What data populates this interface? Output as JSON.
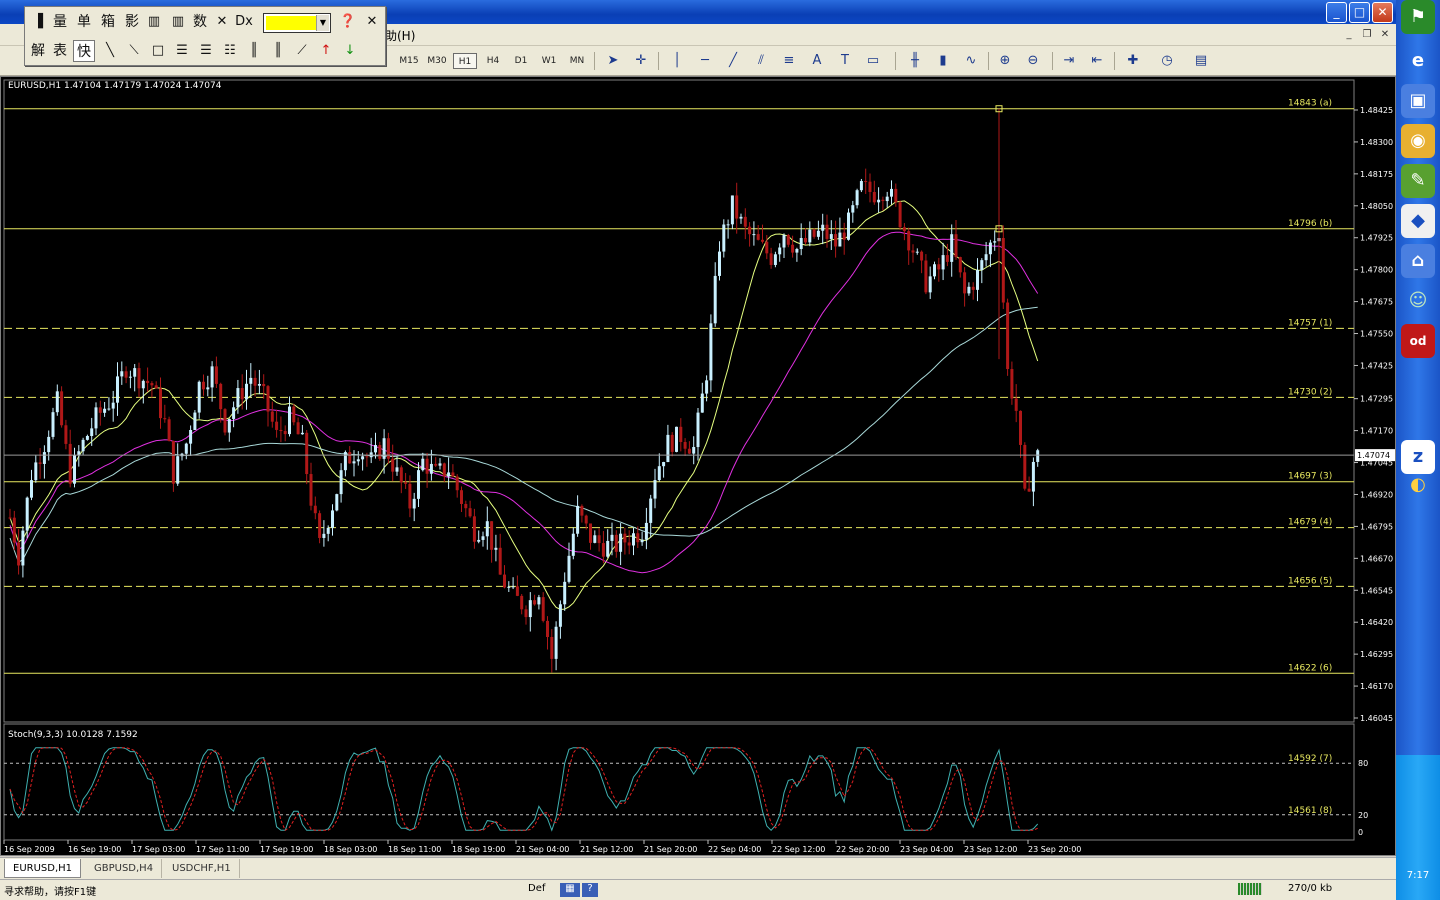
{
  "window": {
    "min_label": "_",
    "max_label": "□",
    "close_label": "✕"
  },
  "menu": {
    "help_label": "助(H)"
  },
  "palette": {
    "row1": [
      "量",
      "单",
      "箱",
      "影",
      "数"
    ],
    "row2": [
      "解",
      "表",
      "快"
    ]
  },
  "toolbar": {
    "timeframes": [
      "M15",
      "M30",
      "H1",
      "H4",
      "D1",
      "W1",
      "MN"
    ],
    "active_timeframe": "H1"
  },
  "chart": {
    "header": "EURUSD,H1  1.47104 1.47179 1.47024 1.47074",
    "price_ticks": [
      "1.48425",
      "1.48300",
      "1.48175",
      "1.48050",
      "1.47925",
      "1.47800",
      "1.47675",
      "1.47550",
      "1.47425",
      "1.47295",
      "1.47170",
      "1.47045",
      "1.46920",
      "1.46795",
      "1.46670",
      "1.46545",
      "1.46420",
      "1.46295",
      "1.46170",
      "1.46045"
    ],
    "current_price": "1.47074",
    "time_ticks": [
      "16 Sep 2009",
      "16 Sep 19:00",
      "17 Sep 03:00",
      "17 Sep 11:00",
      "17 Sep 19:00",
      "18 Sep 03:00",
      "18 Sep 11:00",
      "18 Sep 19:00",
      "21 Sep 04:00",
      "21 Sep 12:00",
      "21 Sep 20:00",
      "22 Sep 04:00",
      "22 Sep 12:00",
      "22 Sep 20:00",
      "23 Sep 04:00",
      "23 Sep 12:00",
      "23 Sep 20:00"
    ],
    "levels": [
      {
        "label": "14843 (a)",
        "price": 1.4843,
        "style": "solid"
      },
      {
        "label": "14796 (b)",
        "price": 1.4796,
        "style": "solid"
      },
      {
        "label": "14757 (1)",
        "price": 1.4757,
        "style": "dashed"
      },
      {
        "label": "14730 (2)",
        "price": 1.473,
        "style": "dashed"
      },
      {
        "label": "14697 (3)",
        "price": 1.4697,
        "style": "solid"
      },
      {
        "label": "14679 (4)",
        "price": 1.4679,
        "style": "dashed"
      },
      {
        "label": "14656 (5)",
        "price": 1.4656,
        "style": "dashed"
      },
      {
        "label": "14622 (6)",
        "price": 1.4622,
        "style": "solid"
      }
    ],
    "stoch_header": "Stoch(9,3,3) 10.0128 7.1592",
    "stoch_ticks": [
      "80",
      "20",
      "0"
    ],
    "stoch_levels": [
      {
        "label": "14592 (7)",
        "value": 80
      },
      {
        "label": "14561 (8)",
        "value": 20
      }
    ],
    "colors": {
      "bull": "#c9f0ff",
      "bear": "#b01818",
      "level": "#e8e860",
      "ma_fast": "#e6ff80",
      "ma_mid": "#e030e0",
      "ma_slow": "#a8d8d8",
      "stoch_main": "#3fb0b0",
      "stoch_signal": "#e02020"
    }
  },
  "tabs": [
    "EURUSD,H1",
    "GBPUSD,H4",
    "USDCHF,H1"
  ],
  "status": {
    "help": "寻求帮助，请按F1键",
    "profile": "Def",
    "traffic": "270/0 kb"
  },
  "dock": {
    "clock": "7:17"
  }
}
